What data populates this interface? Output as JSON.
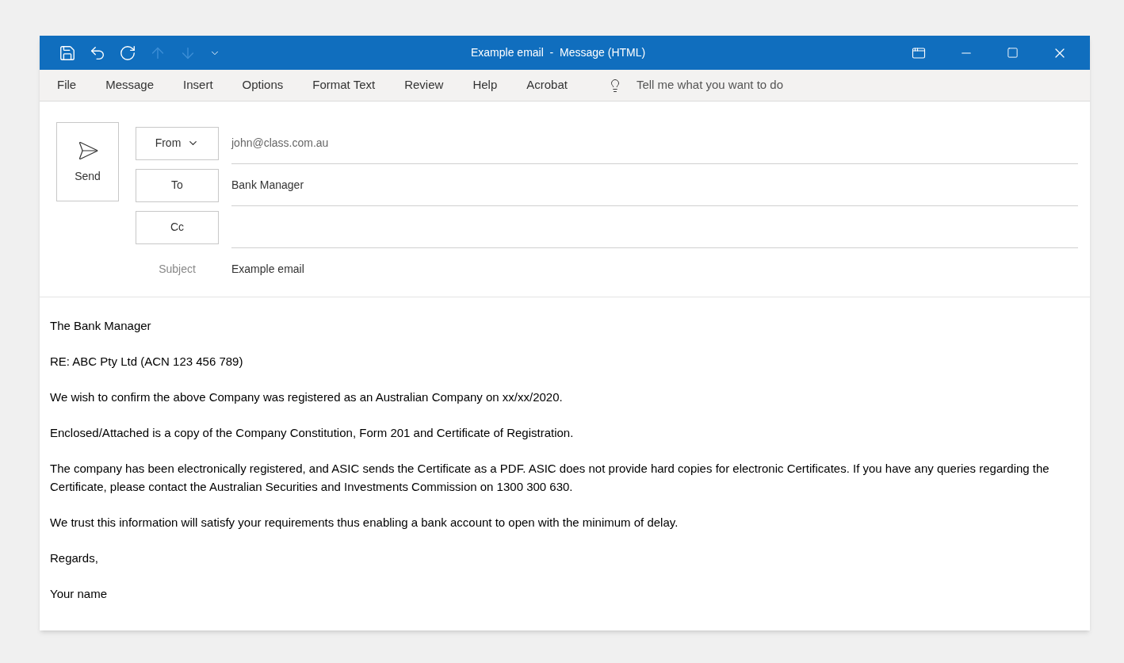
{
  "window": {
    "title": "Example email  -  Message (HTML)"
  },
  "quick_access": [
    {
      "kind": "save",
      "disabled": false
    },
    {
      "kind": "undo",
      "disabled": false
    },
    {
      "kind": "redo",
      "disabled": false
    },
    {
      "kind": "up",
      "disabled": true
    },
    {
      "kind": "down",
      "disabled": true
    },
    {
      "kind": "customize",
      "disabled": false
    }
  ],
  "menu": [
    "File",
    "Message",
    "Insert",
    "Options",
    "Format Text",
    "Review",
    "Help",
    "Acrobat"
  ],
  "tell_me": {
    "placeholder": "Tell me what you want to do"
  },
  "send_button": "Send",
  "fields": [
    {
      "kind": "dropdown",
      "label": "From",
      "value": "john@class.com.au"
    },
    {
      "kind": "button",
      "label": "To",
      "value": "Bank Manager"
    },
    {
      "kind": "button",
      "label": "Cc"
    },
    {
      "kind": "plain",
      "label": "Subject",
      "value": "Example email"
    }
  ],
  "body": [
    "The Bank Manager",
    "RE:  ABC Pty Ltd (ACN 123 456 789)",
    "We wish to confirm the above Company was registered as an Australian Company on xx/xx/2020.",
    "Enclosed/Attached is a copy of the Company Constitution, Form 201 and Certificate of Registration.",
    "The company has been electronically registered, and ASIC sends the Certificate as a PDF. ASIC does not provide hard copies for electronic Certificates. If you have any queries regarding the Certificate, please contact the Australian Securities and Investments Commission on 1300 300 630.",
    "We trust this information will satisfy your requirements thus enabling a bank account to open with the minimum of delay.",
    "Regards,",
    "Your name"
  ]
}
